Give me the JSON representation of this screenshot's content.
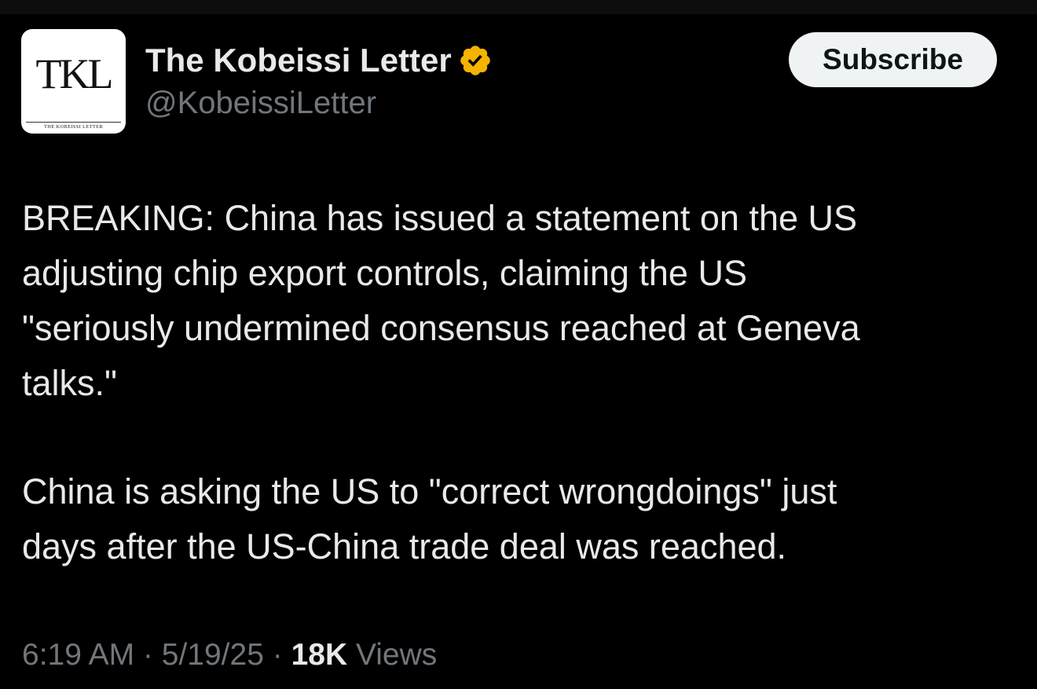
{
  "author": {
    "display_name": "The Kobeissi Letter",
    "handle": "@KobeissiLetter",
    "verified_badge_color": "#f4b400",
    "avatar": {
      "monogram": "TKL",
      "subtitle": "THE KOBEISSI LETTER"
    }
  },
  "actions": {
    "subscribe_label": "Subscribe"
  },
  "post": {
    "paragraph1_lines": [
      "BREAKING: China has issued a statement on the US",
      "adjusting chip export controls, claiming the US",
      "\"seriously undermined consensus reached at Geneva",
      "talks.\""
    ],
    "paragraph2_lines": [
      "China is asking the US to \"correct wrongdoings\" just",
      "days after the US-China trade deal was reached."
    ]
  },
  "meta": {
    "time": "6:19 AM",
    "separator": " · ",
    "date": "5/19/25",
    "views_count": "18K",
    "views_label": " Views"
  },
  "colors": {
    "background": "#000000",
    "primary_text": "#e7e9ea",
    "secondary_text": "#71767b",
    "button_bg": "#eff3f4",
    "button_text": "#0f1419"
  }
}
